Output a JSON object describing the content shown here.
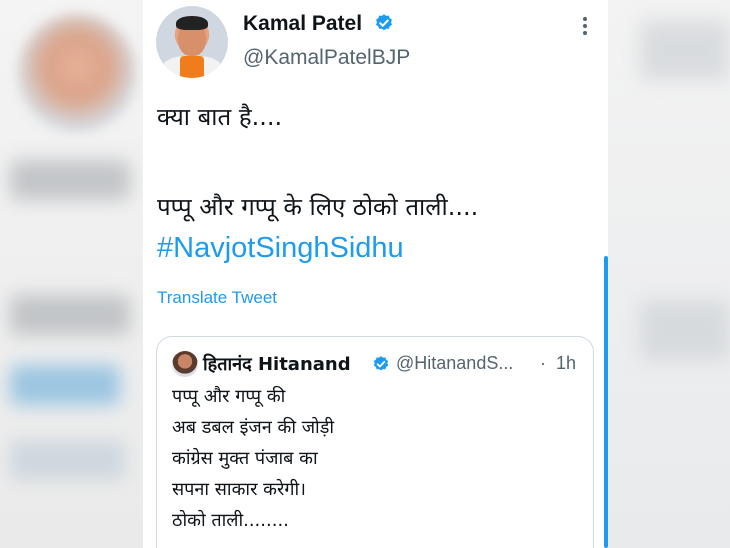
{
  "tweet": {
    "author_name": "Kamal Patel",
    "author_handle": "@KamalPatelBJP",
    "text_line_1": "क्या बात है....",
    "text_line_2": "पप्पू और गप्पू के लिए ठोको ताली....",
    "hashtag": "#NavjotSinghSidhu",
    "translate_label": "Translate Tweet"
  },
  "quoted_tweet": {
    "author_name": "हितानंद Hitanand",
    "author_handle": "@HitanandS...",
    "separator": "·",
    "time": "1h",
    "lines": [
      "पप्पू और गप्पू की",
      "अब डबल इंजन की जोड़ी",
      "कांग्रेस मुक्त पंजाब का",
      "सपना साकार करेगी।",
      "ठोको ताली........"
    ]
  },
  "colors": {
    "accent": "#1d9bf0",
    "text": "#0f1419",
    "muted": "#536471",
    "border": "#cfd9de"
  }
}
